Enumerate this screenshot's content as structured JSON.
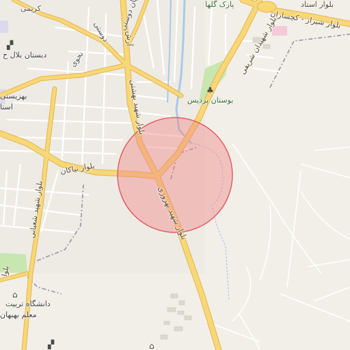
{
  "map": {
    "labels": {
      "karimi": "کریمی",
      "jahan_doost_1": "جهان دوستی",
      "jahan_doost_2": "دوستی",
      "park_golha": "پارک گلها",
      "bolvar_top_right": "بلوار استاد",
      "bolvar_shiraz": "بلوار شیراز - کچساران",
      "shahidan_sharifi": "بلوار شهیدان شریفی",
      "school_bilal": "دبستان بلال ح",
      "nahavi": "نحوی",
      "bostan_pardis": "بوستان پردیس",
      "behzisti_1": "بهزیستی",
      "behzisti_2": "استا",
      "shahid_beheshti": "بلوار شهید بهشتی",
      "bolvar_niakan": "بلوار نیاکان",
      "shahid_shabani": "بلوار شهید شعبانی",
      "shahid_behrooz": "بلوار شهید بهروزی",
      "university_1": "دانشگاه تربیت",
      "university_2": "معلم بهبهان",
      "bolvar_left": "بلوا",
      "arash": "آرش"
    },
    "icons": {
      "school": "school-icon",
      "park": "tree-icon",
      "university": "university-icon"
    },
    "colors": {
      "background": "#f2efe9",
      "major_road": "#f6cf6a",
      "minor_road": "#ffffff",
      "park": "#c8e6b0",
      "water": "#a9c8e8",
      "highlight_fill": "#f08a8a",
      "highlight_stroke": "#e06060"
    }
  }
}
